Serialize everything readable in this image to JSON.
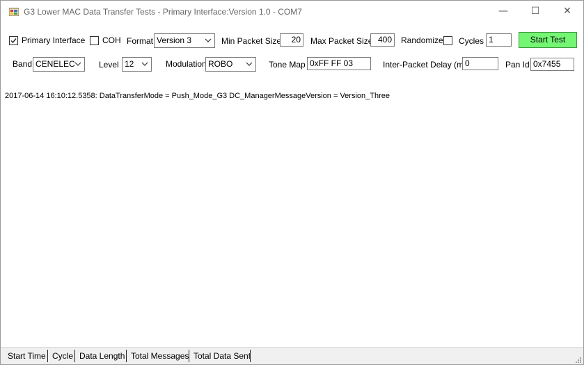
{
  "window": {
    "title": "G3 Lower MAC Data Transfer Tests - Primary Interface:Version 1.0 - COM7",
    "minimize_glyph": "—",
    "maximize_glyph": "☐",
    "close_glyph": "✕"
  },
  "row1": {
    "primary_interface": {
      "label": "Primary Interface",
      "checked": true
    },
    "coh": {
      "label": "COH",
      "checked": false
    },
    "format": {
      "label": "Format",
      "value": "Version 3"
    },
    "min_packet_size": {
      "label": "Min Packet Size",
      "value": "20"
    },
    "max_packet_size": {
      "label": "Max Packet Size",
      "value": "400"
    },
    "randomize": {
      "label": "Randomize",
      "checked": false
    },
    "cycles": {
      "label": "Cycles",
      "value": "1"
    },
    "start_button": {
      "label": "Start Test",
      "color": "#74f574"
    }
  },
  "row2": {
    "band": {
      "label": "Band",
      "value": "CENELEC"
    },
    "level": {
      "label": "Level",
      "value": "12"
    },
    "modulation": {
      "label": "Modulation",
      "value": "ROBO"
    },
    "tone_map": {
      "label": "Tone Map",
      "value": "0xFF FF 03"
    },
    "inter_packet_delay": {
      "label": "Inter-Packet Delay (ms)",
      "value": "0"
    },
    "pan_id": {
      "label": "Pan Id",
      "value": "0x7455"
    }
  },
  "log": {
    "lines": [
      "2017-06-14 16:10:12.5358:   DataTransferMode = Push_Mode_G3 DC_ManagerMessageVersion = Version_Three"
    ]
  },
  "statusbar": {
    "items": [
      "Start Time",
      "Cycle",
      "Data Length",
      "Total Messages",
      "Total Data Sent"
    ]
  }
}
